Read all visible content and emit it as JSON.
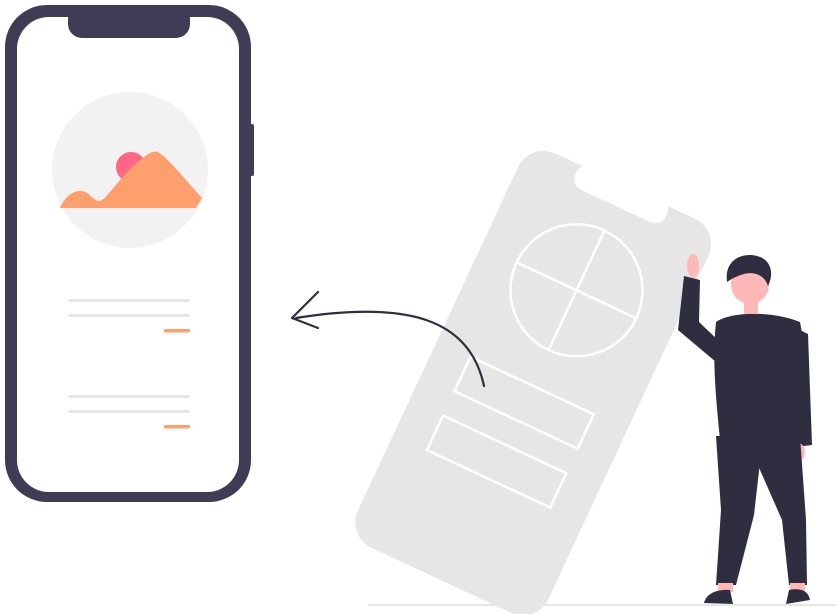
{
  "colors": {
    "phone_frame": "#3F3D56",
    "phone_screen": "#FFFFFF",
    "image_circle": "#F2F2F2",
    "mountain": "#FF9F6E",
    "sun": "#FF6584",
    "text_line": "#E6E6E6",
    "accent_line": "#FF9F6E",
    "tilted_phone": "#E6E6E6",
    "tilted_phone_detail": "#FFFFFF",
    "arrow": "#2F2E41",
    "person_clothes": "#2F2E41",
    "person_skin": "#FFB8B8",
    "ground": "#E6E6E6"
  },
  "icons": {
    "foreground_phone": "smartphone-icon",
    "screen_image": "image-placeholder-icon",
    "arrow": "curved-arrow-left-icon",
    "pie": "pie-chart-icon",
    "person": "person-icon"
  }
}
